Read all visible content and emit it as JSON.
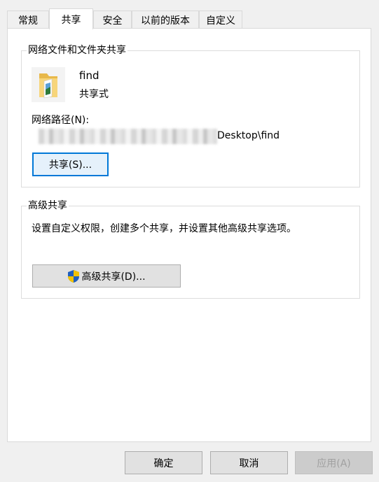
{
  "tabs": [
    "常规",
    "共享",
    "安全",
    "以前的版本",
    "自定义"
  ],
  "network_share": {
    "group_title": "网络文件和文件夹共享",
    "folder_name": "find",
    "share_status": "共享式",
    "path_label": "网络路径(N):",
    "path_value": "Desktop\\find",
    "share_button": "共享(S)..."
  },
  "advanced_share": {
    "group_title": "高级共享",
    "description": "设置自定义权限，创建多个共享，并设置其他高级共享选项。",
    "button": "高级共享(D)..."
  },
  "footer": {
    "ok": "确定",
    "cancel": "取消",
    "apply": "应用(A)"
  },
  "colors": {
    "focus_border": "#0078d7",
    "shield_blue": "#1f5fbf",
    "shield_yellow": "#f2c200"
  },
  "icons": {
    "folder": "shared-folder-icon",
    "shield": "uac-shield-icon"
  }
}
